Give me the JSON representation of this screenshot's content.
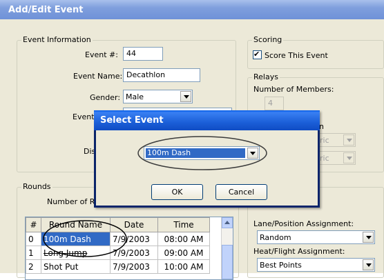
{
  "window": {
    "title": "Add/Edit Event"
  },
  "event_info": {
    "group_label": "Event Information",
    "event_num_label": "Event #:",
    "event_num_value": "44",
    "event_name_label": "Event Name:",
    "event_name_value": "Decathlon",
    "gender_label": "Gender:",
    "gender_value": "Male",
    "event_type_label": "Event",
    "distance_label": "Dis"
  },
  "scoring": {
    "group_label": "Scoring",
    "score_checkbox_label": "Score This Event",
    "score_checked": true
  },
  "relays": {
    "group_label": "Relays",
    "members_label": "Number of Members:",
    "members_value": "4",
    "hidden_label_fragment": "n",
    "combo1_value": "ric",
    "combo2_value": "ric"
  },
  "rounds": {
    "group_label": "Rounds",
    "number_label": "Number of Rou",
    "columns": [
      "#",
      "Round Name",
      "Date",
      "Time"
    ],
    "rows": [
      {
        "num": "0",
        "name": "100m Dash",
        "date": "7/9/2003",
        "time": "08:00 AM"
      },
      {
        "num": "1",
        "name": "Long Jump",
        "date": "7/9/2003",
        "time": "09:00 AM"
      },
      {
        "num": "2",
        "name": "Shot Put",
        "date": "7/9/2003",
        "time": "10:00 AM"
      }
    ]
  },
  "assignments": {
    "lane_label": "Lane/Position Assignment:",
    "lane_value": "Random",
    "heat_label": "Heat/Flight Assignment:",
    "heat_value": "Best Points"
  },
  "dialog": {
    "title": "Select Event",
    "selected_event": "100m Dash",
    "ok_label": "OK",
    "cancel_label": "Cancel"
  }
}
